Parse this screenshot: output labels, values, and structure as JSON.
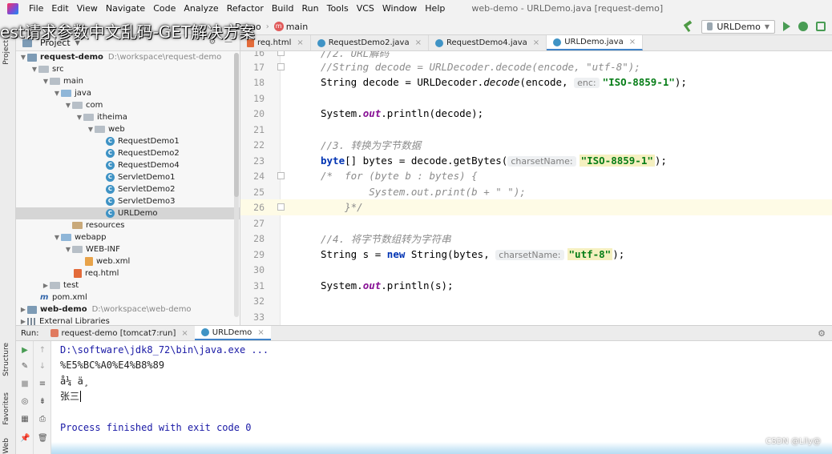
{
  "window": {
    "title": "web-demo - URLDemo.java [request-demo]",
    "menu": [
      "File",
      "Edit",
      "View",
      "Navigate",
      "Code",
      "Analyze",
      "Refactor",
      "Build",
      "Run",
      "Tools",
      "VCS",
      "Window",
      "Help"
    ]
  },
  "overlay": {
    "video_title": "est请求参数中文乱码-GET解决方案",
    "watermark": "CSDN @Lily@"
  },
  "toolbar": {
    "crumb_class": "Demo",
    "crumb_method": "main",
    "run_config": "URLDemo"
  },
  "left_strip": {
    "project": "Project",
    "structure": "Structure",
    "favorites": "Favorites",
    "web": "Web"
  },
  "project_pane": {
    "title": "Project",
    "tree": [
      {
        "label": "request-demo",
        "hint": "D:\\workspace\\request-demo",
        "bold": true
      },
      {
        "label": "src"
      },
      {
        "label": "main"
      },
      {
        "label": "java"
      },
      {
        "label": "com"
      },
      {
        "label": "itheima"
      },
      {
        "label": "web"
      },
      {
        "label": "RequestDemo1"
      },
      {
        "label": "RequestDemo2"
      },
      {
        "label": "RequestDemo4"
      },
      {
        "label": "ServletDemo1"
      },
      {
        "label": "ServletDemo2"
      },
      {
        "label": "ServletDemo3"
      },
      {
        "label": "URLDemo"
      },
      {
        "label": "resources"
      },
      {
        "label": "webapp"
      },
      {
        "label": "WEB-INF"
      },
      {
        "label": "web.xml"
      },
      {
        "label": "req.html"
      },
      {
        "label": "test"
      },
      {
        "label": "pom.xml"
      },
      {
        "label": "web-demo",
        "hint": "D:\\workspace\\web-demo",
        "bold": true
      },
      {
        "label": "External Libraries"
      }
    ]
  },
  "editor": {
    "tabs": [
      {
        "label": "req.html"
      },
      {
        "label": "RequestDemo2.java"
      },
      {
        "label": "RequestDemo4.java"
      },
      {
        "label": "URLDemo.java"
      }
    ],
    "line_numbers": [
      "16",
      "17",
      "18",
      "19",
      "20",
      "21",
      "22",
      "23",
      "24",
      "25",
      "26",
      "27",
      "28",
      "29",
      "30",
      "31",
      "32",
      "33"
    ],
    "code": {
      "l16": "//2. URL解码",
      "l17": "//String decode = URLDecoder.decode(encode, \"utf-8\");",
      "l18_a": "String decode = URLDecoder.",
      "l18_b": "decode",
      "l18_c": "(encode, ",
      "l18_hint": "enc:",
      "l18_str": "\"ISO-8859-1\"",
      "l18_d": ");",
      "l20_a": "System.",
      "l20_b": "out",
      "l20_c": ".println(decode);",
      "l22": "//3. 转换为字节数据",
      "l23_kw": "byte",
      "l23_a": "[] bytes = decode.getBytes(",
      "l23_hint": "charsetName:",
      "l23_str": "\"ISO-8859-1\"",
      "l23_b": ");",
      "l24": "/*  for (byte b : bytes) {",
      "l25": "        System.out.print(b + \" \");",
      "l26": "    }*/",
      "l28": "//4. 将字节数组转为字符串",
      "l29_a": "String s = ",
      "l29_kw": "new",
      "l29_b": " String(bytes, ",
      "l29_hint": "charsetName:",
      "l29_str": "\"utf-8\"",
      "l29_c": ");",
      "l31_a": "System.",
      "l31_b": "out",
      "l31_c": ".println(s);"
    }
  },
  "run_panel": {
    "label": "Run:",
    "tabs": [
      {
        "label": "request-demo [tomcat7:run]"
      },
      {
        "label": "URLDemo"
      }
    ],
    "console": [
      "D:\\software\\jdk8_72\\bin\\java.exe ...",
      "%E5%BC%A0%E4%B8%89",
      "å¼ ä¸",
      "张三",
      "",
      "Process finished with exit code 0"
    ]
  }
}
